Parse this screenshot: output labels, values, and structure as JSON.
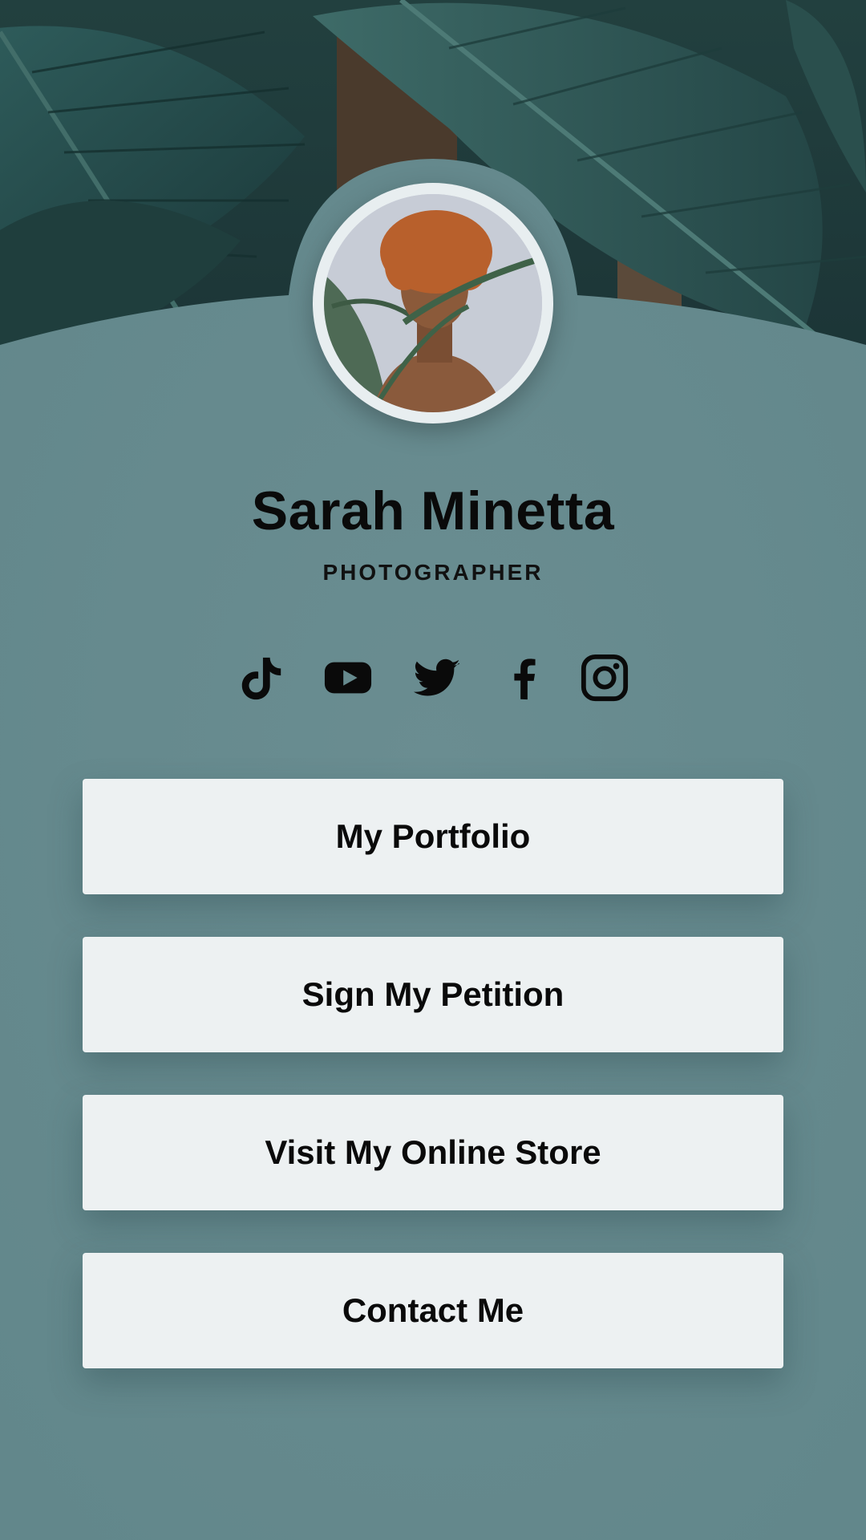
{
  "profile": {
    "name": "Sarah Minetta",
    "role": "PHOTOGRAPHER",
    "avatar_description": ""
  },
  "social_icons": [
    "tiktok-icon",
    "youtube-icon",
    "twitter-icon",
    "facebook-icon",
    "instagram-icon"
  ],
  "buttons": [
    {
      "label": "My Portfolio"
    },
    {
      "label": "Sign My Petition"
    },
    {
      "label": "Visit My Online Store"
    },
    {
      "label": "Contact Me"
    }
  ],
  "colors": {
    "background": "#668a8e",
    "button": "#edf1f2",
    "text": "#0a0a0a",
    "leaf_dark": "#1c3a3c",
    "leaf_mid": "#2d5a5a"
  }
}
